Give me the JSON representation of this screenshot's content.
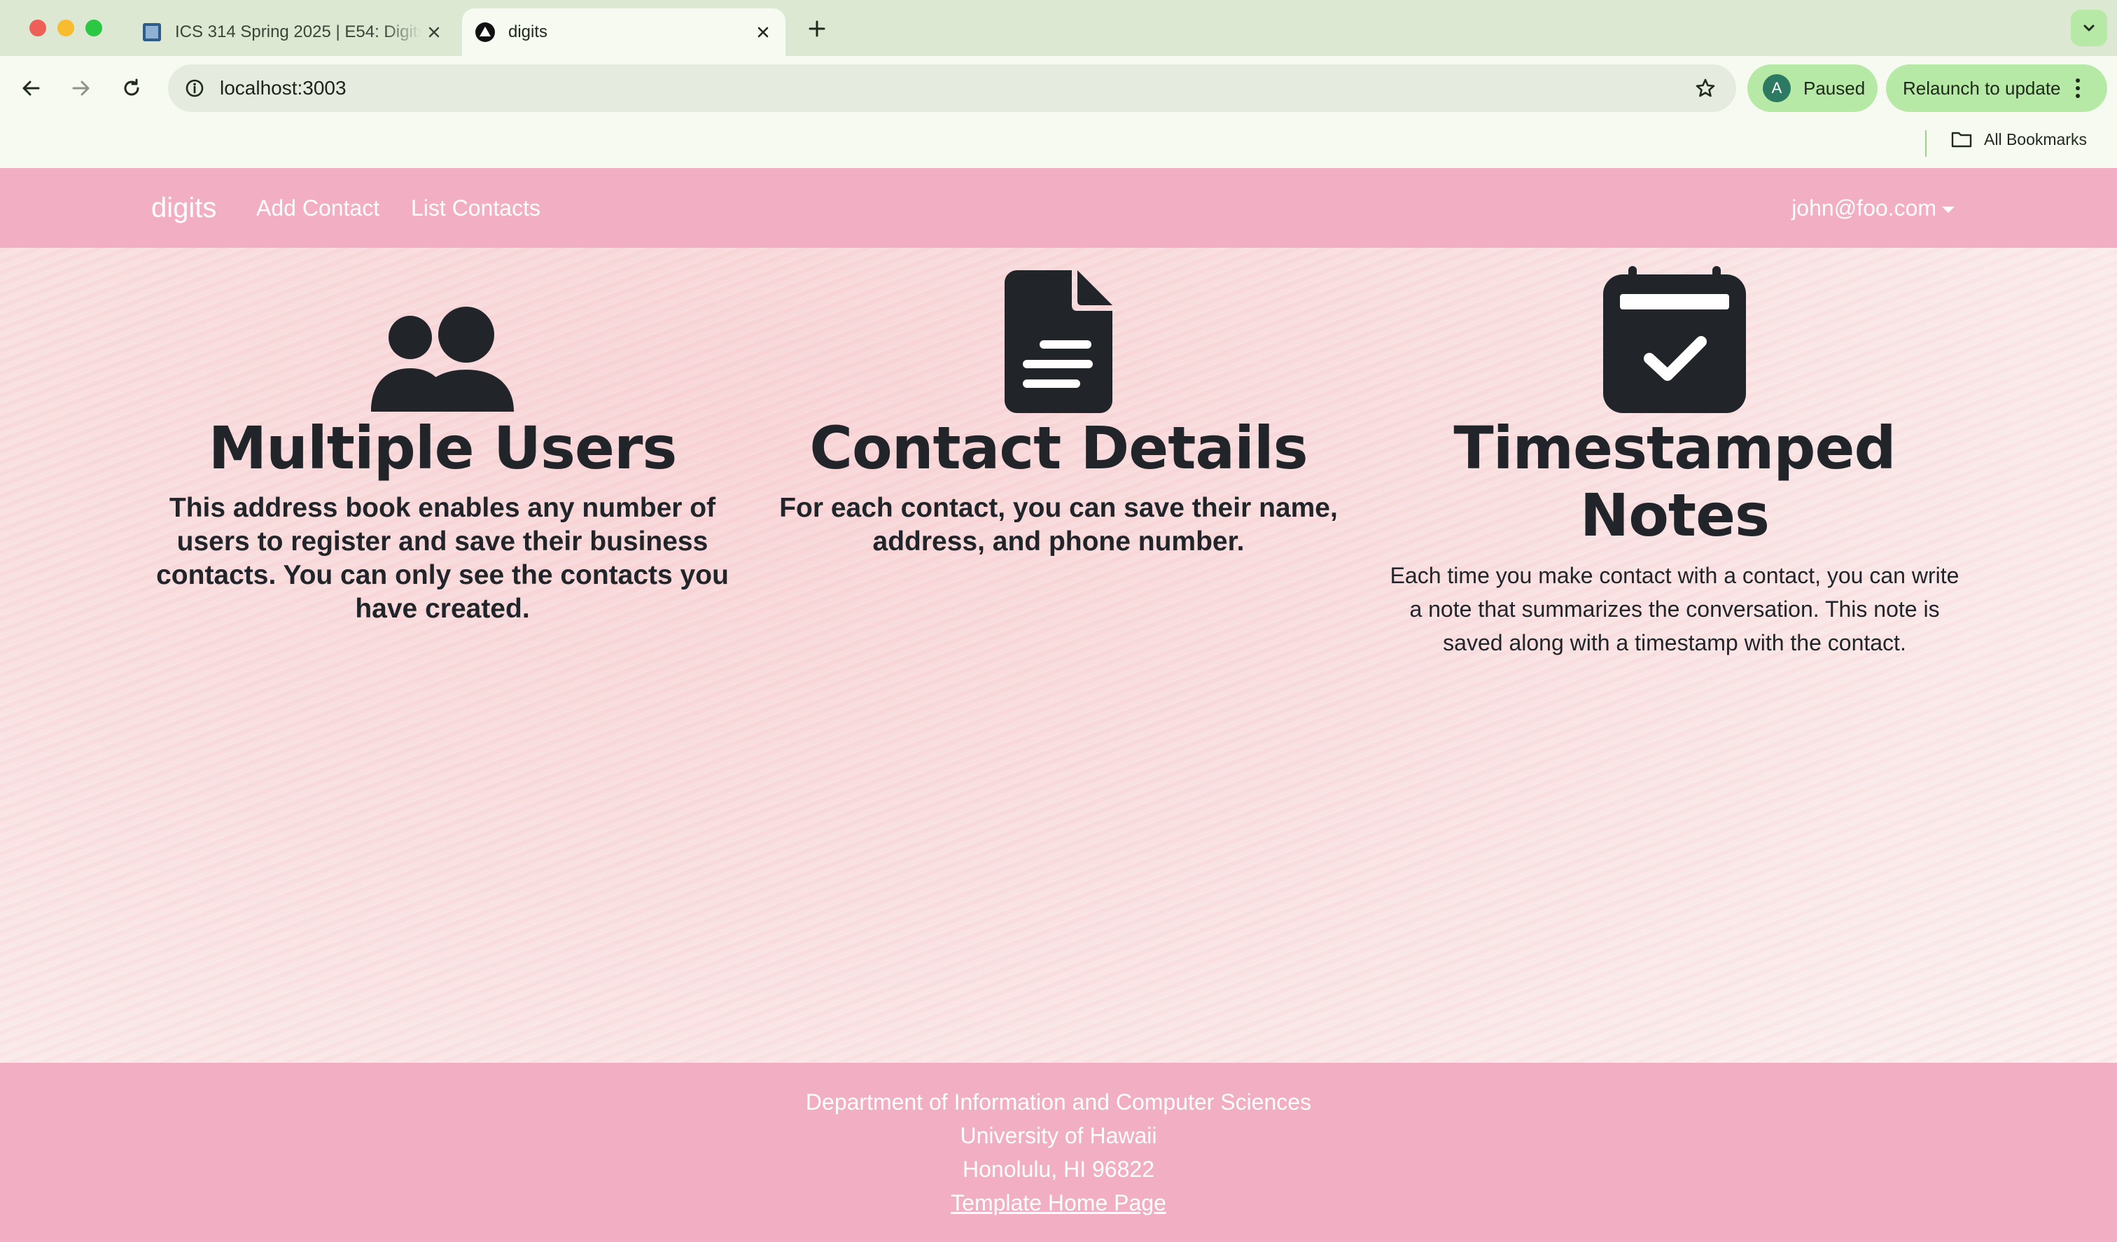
{
  "browser": {
    "tabs": [
      {
        "title": "ICS 314 Spring 2025 | E54: Digits",
        "active": false
      },
      {
        "title": "digits",
        "active": true
      }
    ],
    "address": "localhost:3003",
    "paused_label": "Paused",
    "avatar_letter": "A",
    "relaunch_label": "Relaunch to update",
    "bookmarks_label": "All Bookmarks"
  },
  "site": {
    "brand": "digits",
    "nav_links": [
      "Add Contact",
      "List Contacts"
    ],
    "user_email": "john@foo.com",
    "features": [
      {
        "icon": "users-icon",
        "title": "Multiple Users",
        "text": "This address book enables any number of users to register and save their business contacts. You can only see the contacts you have created."
      },
      {
        "icon": "file-lines-icon",
        "title": "Contact Details",
        "text": "For each contact, you can save their name, address, and phone number."
      },
      {
        "icon": "calendar-check-icon",
        "title": "Timestamped Notes",
        "text": "Each time you make contact with a contact, you can write a note that summarizes the conversation. This note is saved along with a timestamp with the contact."
      }
    ],
    "footer": {
      "lines": [
        "Department of Information and Computer Sciences",
        "University of Hawaii",
        "Honolulu, HI 96822"
      ],
      "link": "Template Home Page"
    }
  },
  "colors": {
    "navbar": "#f2aec2",
    "browser_accent": "#b6e8a6",
    "text_dark": "#21252a"
  }
}
